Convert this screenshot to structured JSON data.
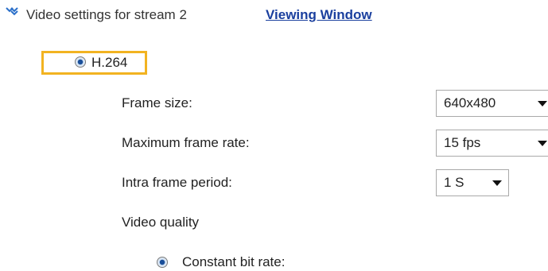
{
  "section": {
    "icon": "double-chevron-down-icon",
    "title": "Video settings for stream 2",
    "viewing_window_link": "Viewing Window"
  },
  "codec": {
    "label": "H.264",
    "selected": true,
    "highlight_color": "#f2b321"
  },
  "fields": {
    "frame_size": {
      "label": "Frame size:",
      "value": "640x480"
    },
    "max_frame_rate": {
      "label": "Maximum frame rate:",
      "value": "15 fps"
    },
    "intra_frame_period": {
      "label": "Intra frame period:",
      "value": "1 S"
    },
    "video_quality": {
      "label": "Video quality"
    }
  },
  "quality_options": {
    "constant_bit_rate": {
      "label": "Constant bit rate:",
      "selected": true
    }
  },
  "colors": {
    "link": "#1a3f9e",
    "icon": "#2a6fc9"
  }
}
